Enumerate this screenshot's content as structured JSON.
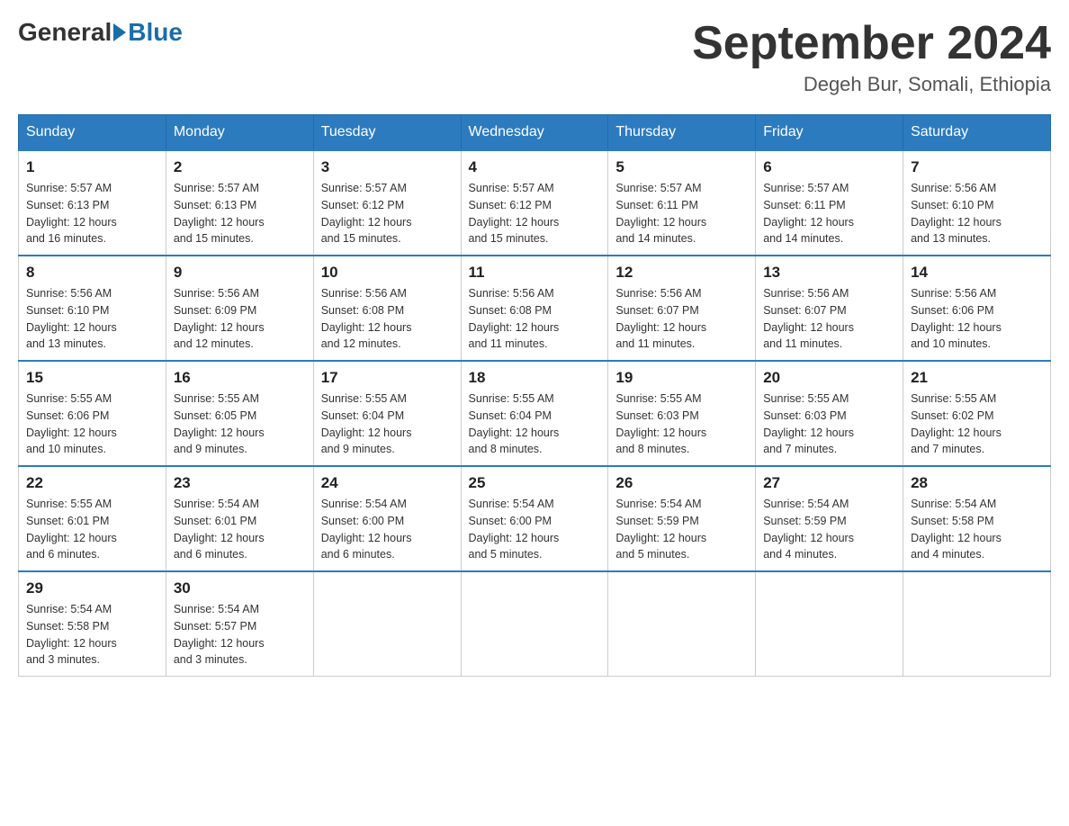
{
  "logo": {
    "general": "General",
    "blue": "Blue"
  },
  "title": "September 2024",
  "location": "Degeh Bur, Somali, Ethiopia",
  "headers": [
    "Sunday",
    "Monday",
    "Tuesday",
    "Wednesday",
    "Thursday",
    "Friday",
    "Saturday"
  ],
  "weeks": [
    [
      {
        "day": "1",
        "info": "Sunrise: 5:57 AM\nSunset: 6:13 PM\nDaylight: 12 hours\nand 16 minutes."
      },
      {
        "day": "2",
        "info": "Sunrise: 5:57 AM\nSunset: 6:13 PM\nDaylight: 12 hours\nand 15 minutes."
      },
      {
        "day": "3",
        "info": "Sunrise: 5:57 AM\nSunset: 6:12 PM\nDaylight: 12 hours\nand 15 minutes."
      },
      {
        "day": "4",
        "info": "Sunrise: 5:57 AM\nSunset: 6:12 PM\nDaylight: 12 hours\nand 15 minutes."
      },
      {
        "day": "5",
        "info": "Sunrise: 5:57 AM\nSunset: 6:11 PM\nDaylight: 12 hours\nand 14 minutes."
      },
      {
        "day": "6",
        "info": "Sunrise: 5:57 AM\nSunset: 6:11 PM\nDaylight: 12 hours\nand 14 minutes."
      },
      {
        "day": "7",
        "info": "Sunrise: 5:56 AM\nSunset: 6:10 PM\nDaylight: 12 hours\nand 13 minutes."
      }
    ],
    [
      {
        "day": "8",
        "info": "Sunrise: 5:56 AM\nSunset: 6:10 PM\nDaylight: 12 hours\nand 13 minutes."
      },
      {
        "day": "9",
        "info": "Sunrise: 5:56 AM\nSunset: 6:09 PM\nDaylight: 12 hours\nand 12 minutes."
      },
      {
        "day": "10",
        "info": "Sunrise: 5:56 AM\nSunset: 6:08 PM\nDaylight: 12 hours\nand 12 minutes."
      },
      {
        "day": "11",
        "info": "Sunrise: 5:56 AM\nSunset: 6:08 PM\nDaylight: 12 hours\nand 11 minutes."
      },
      {
        "day": "12",
        "info": "Sunrise: 5:56 AM\nSunset: 6:07 PM\nDaylight: 12 hours\nand 11 minutes."
      },
      {
        "day": "13",
        "info": "Sunrise: 5:56 AM\nSunset: 6:07 PM\nDaylight: 12 hours\nand 11 minutes."
      },
      {
        "day": "14",
        "info": "Sunrise: 5:56 AM\nSunset: 6:06 PM\nDaylight: 12 hours\nand 10 minutes."
      }
    ],
    [
      {
        "day": "15",
        "info": "Sunrise: 5:55 AM\nSunset: 6:06 PM\nDaylight: 12 hours\nand 10 minutes."
      },
      {
        "day": "16",
        "info": "Sunrise: 5:55 AM\nSunset: 6:05 PM\nDaylight: 12 hours\nand 9 minutes."
      },
      {
        "day": "17",
        "info": "Sunrise: 5:55 AM\nSunset: 6:04 PM\nDaylight: 12 hours\nand 9 minutes."
      },
      {
        "day": "18",
        "info": "Sunrise: 5:55 AM\nSunset: 6:04 PM\nDaylight: 12 hours\nand 8 minutes."
      },
      {
        "day": "19",
        "info": "Sunrise: 5:55 AM\nSunset: 6:03 PM\nDaylight: 12 hours\nand 8 minutes."
      },
      {
        "day": "20",
        "info": "Sunrise: 5:55 AM\nSunset: 6:03 PM\nDaylight: 12 hours\nand 7 minutes."
      },
      {
        "day": "21",
        "info": "Sunrise: 5:55 AM\nSunset: 6:02 PM\nDaylight: 12 hours\nand 7 minutes."
      }
    ],
    [
      {
        "day": "22",
        "info": "Sunrise: 5:55 AM\nSunset: 6:01 PM\nDaylight: 12 hours\nand 6 minutes."
      },
      {
        "day": "23",
        "info": "Sunrise: 5:54 AM\nSunset: 6:01 PM\nDaylight: 12 hours\nand 6 minutes."
      },
      {
        "day": "24",
        "info": "Sunrise: 5:54 AM\nSunset: 6:00 PM\nDaylight: 12 hours\nand 6 minutes."
      },
      {
        "day": "25",
        "info": "Sunrise: 5:54 AM\nSunset: 6:00 PM\nDaylight: 12 hours\nand 5 minutes."
      },
      {
        "day": "26",
        "info": "Sunrise: 5:54 AM\nSunset: 5:59 PM\nDaylight: 12 hours\nand 5 minutes."
      },
      {
        "day": "27",
        "info": "Sunrise: 5:54 AM\nSunset: 5:59 PM\nDaylight: 12 hours\nand 4 minutes."
      },
      {
        "day": "28",
        "info": "Sunrise: 5:54 AM\nSunset: 5:58 PM\nDaylight: 12 hours\nand 4 minutes."
      }
    ],
    [
      {
        "day": "29",
        "info": "Sunrise: 5:54 AM\nSunset: 5:58 PM\nDaylight: 12 hours\nand 3 minutes."
      },
      {
        "day": "30",
        "info": "Sunrise: 5:54 AM\nSunset: 5:57 PM\nDaylight: 12 hours\nand 3 minutes."
      },
      {
        "day": "",
        "info": ""
      },
      {
        "day": "",
        "info": ""
      },
      {
        "day": "",
        "info": ""
      },
      {
        "day": "",
        "info": ""
      },
      {
        "day": "",
        "info": ""
      }
    ]
  ]
}
